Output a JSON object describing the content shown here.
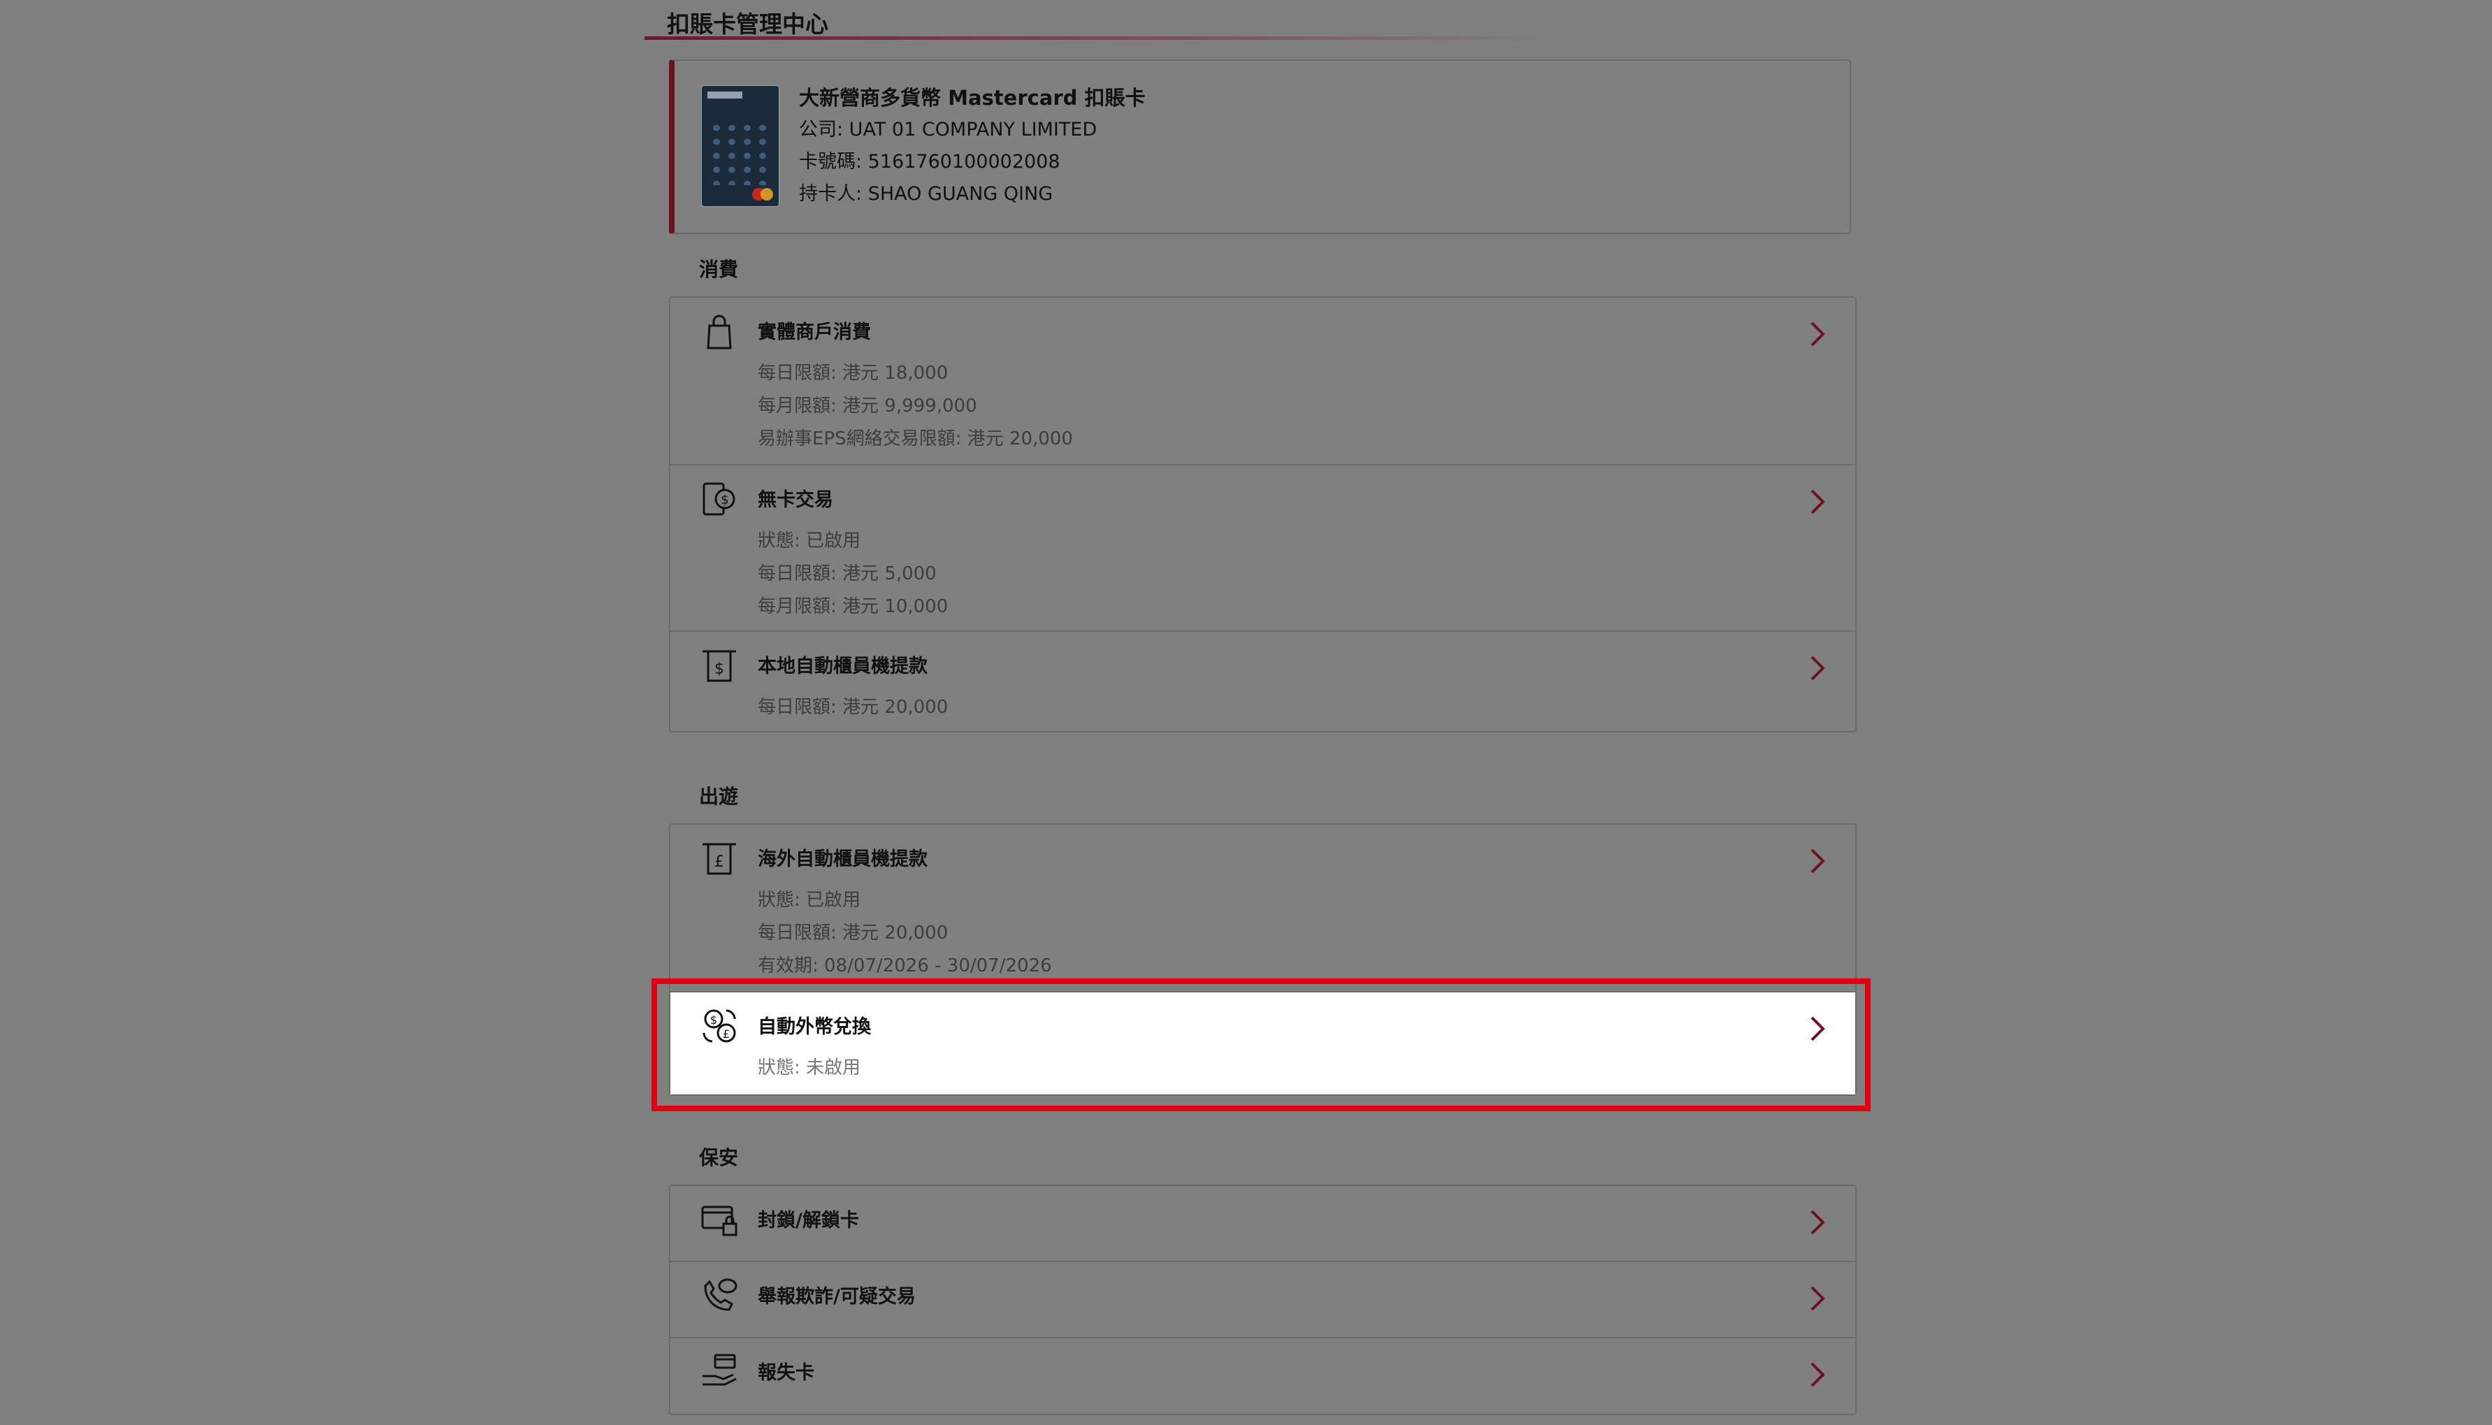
{
  "page": {
    "title": "扣賬卡管理中心"
  },
  "card": {
    "name": "大新營商多貨幣 Mastercard 扣賬卡",
    "company": "公司: UAT 01 COMPANY LIMITED",
    "number": "卡號碼: 5161760100002008",
    "holder": "持卡人: SHAO GUANG QING"
  },
  "sections": {
    "spending": "消費",
    "travel": "出遊",
    "security": "保安"
  },
  "spending": {
    "retail": {
      "label": "實體商戶消費",
      "d1": "每日限額:  港元 18,000",
      "d2": "每月限額:  港元 9,999,000",
      "d3": "易辦事EPS網絡交易限額:  港元 20,000"
    },
    "cardless": {
      "label": "無卡交易",
      "d1": "狀態:  已啟用",
      "d2": "每日限額:  港元 5,000",
      "d3": "每月限額:  港元 10,000"
    },
    "local_atm": {
      "label": "本地自動櫃員機提款",
      "d1": "每日限額:  港元 20,000"
    }
  },
  "travel": {
    "overseas_atm": {
      "label": "海外自動櫃員機提款",
      "d1": "狀態:  已啟用",
      "d2": "每日限額:  港元 20,000",
      "d3": "有效期:  08/07/2026 - 30/07/2026"
    },
    "fx": {
      "label": "自動外幣兌換",
      "d1": "狀態:  未啟用"
    }
  },
  "security": {
    "lock": {
      "label": "封鎖/解鎖卡"
    },
    "fraud": {
      "label": "舉報欺詐/可疑交易"
    },
    "lost": {
      "label": "報失卡"
    }
  },
  "icons": {
    "retail": "shopping-bag-icon",
    "cardless": "phone-dollar-icon",
    "local_atm": "atm-dollar-icon",
    "overseas_atm": "atm-pound-icon",
    "fx": "currency-exchange-icon",
    "lock": "card-lock-icon",
    "fraud": "phone-speech-icon",
    "lost": "hand-card-icon",
    "chevron": "chevron-right-icon"
  },
  "colors": {
    "accent": "#6e1127",
    "highlight": "#e0000f",
    "overlay": "#7f7f7f"
  }
}
